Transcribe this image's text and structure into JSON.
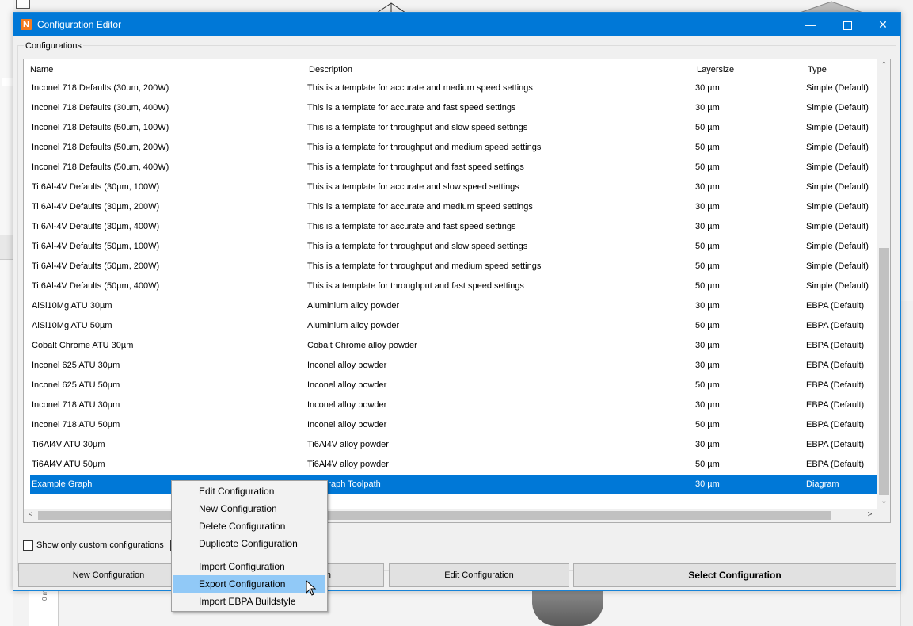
{
  "window": {
    "title": "Configuration Editor",
    "app_icon_letter": "N",
    "minimize": "—",
    "close": "✕"
  },
  "group": {
    "label": "Configurations"
  },
  "table": {
    "columns": [
      "Name",
      "Description",
      "Layersize",
      "Type"
    ],
    "rows": [
      {
        "name": "Inconel 718 Defaults (30µm, 200W)",
        "description": "This is a template for accurate and medium speed settings",
        "layersize": "30 µm",
        "type": "Simple (Default)"
      },
      {
        "name": "Inconel 718 Defaults (30µm, 400W)",
        "description": "This is a template for accurate and fast speed settings",
        "layersize": "30 µm",
        "type": "Simple (Default)"
      },
      {
        "name": "Inconel 718 Defaults (50µm, 100W)",
        "description": "This is a template for throughput and slow speed settings",
        "layersize": "50 µm",
        "type": "Simple (Default)"
      },
      {
        "name": "Inconel 718 Defaults (50µm, 200W)",
        "description": "This is a template for throughput and medium speed settings",
        "layersize": "50 µm",
        "type": "Simple (Default)"
      },
      {
        "name": "Inconel 718 Defaults (50µm, 400W)",
        "description": "This is a template for throughput and fast speed settings",
        "layersize": "50 µm",
        "type": "Simple (Default)"
      },
      {
        "name": "Ti 6Al-4V Defaults (30µm, 100W)",
        "description": "This is a template for accurate and slow speed settings",
        "layersize": "30 µm",
        "type": "Simple (Default)"
      },
      {
        "name": "Ti 6Al-4V Defaults (30µm, 200W)",
        "description": "This is a template for accurate and medium speed settings",
        "layersize": "30 µm",
        "type": "Simple (Default)"
      },
      {
        "name": "Ti 6Al-4V Defaults (30µm, 400W)",
        "description": "This is a template for accurate and fast speed settings",
        "layersize": "30 µm",
        "type": "Simple (Default)"
      },
      {
        "name": "Ti 6Al-4V Defaults (50µm, 100W)",
        "description": "This is a template for throughput and slow speed settings",
        "layersize": "50 µm",
        "type": "Simple (Default)"
      },
      {
        "name": "Ti 6Al-4V Defaults (50µm, 200W)",
        "description": "This is a template for throughput and medium speed settings",
        "layersize": "50 µm",
        "type": "Simple (Default)"
      },
      {
        "name": "Ti 6Al-4V Defaults (50µm, 400W)",
        "description": "This is a template for throughput and fast speed settings",
        "layersize": "50 µm",
        "type": "Simple (Default)"
      },
      {
        "name": "AlSi10Mg ATU 30µm",
        "description": "Aluminium alloy powder",
        "layersize": "30 µm",
        "type": "EBPA (Default)"
      },
      {
        "name": "AlSi10Mg ATU 50µm",
        "description": "Aluminium alloy powder",
        "layersize": "50 µm",
        "type": "EBPA (Default)"
      },
      {
        "name": "Cobalt Chrome ATU 30µm",
        "description": "Cobalt Chrome alloy powder",
        "layersize": "30 µm",
        "type": "EBPA (Default)"
      },
      {
        "name": "Inconel 625 ATU 30µm",
        "description": "Inconel alloy powder",
        "layersize": "30 µm",
        "type": "EBPA (Default)"
      },
      {
        "name": "Inconel 625 ATU 50µm",
        "description": "Inconel alloy powder",
        "layersize": "50 µm",
        "type": "EBPA (Default)"
      },
      {
        "name": "Inconel 718 ATU 30µm",
        "description": "Inconel alloy powder",
        "layersize": "30 µm",
        "type": "EBPA (Default)"
      },
      {
        "name": "Inconel 718 ATU 50µm",
        "description": "Inconel alloy powder",
        "layersize": "50 µm",
        "type": "EBPA (Default)"
      },
      {
        "name": "Ti6Al4V ATU 30µm",
        "description": "Ti6Al4V alloy powder",
        "layersize": "30 µm",
        "type": "EBPA (Default)"
      },
      {
        "name": "Ti6Al4V ATU 50µm",
        "description": "Ti6Al4V alloy powder",
        "layersize": "50 µm",
        "type": "EBPA (Default)"
      },
      {
        "name": "Example Graph",
        "description": "ple Graph Toolpath",
        "layersize": "30 µm",
        "type": "Diagram",
        "selected": true
      }
    ]
  },
  "checkbox": {
    "label": "Show only custom configurations",
    "checked": false
  },
  "buttons": {
    "new": "New Configuration",
    "delete_partial": "n",
    "edit": "Edit Configuration",
    "select": "Select Configuration"
  },
  "context_menu": {
    "items": [
      "Edit Configuration",
      "New Configuration",
      "Delete Configuration",
      "Duplicate Configuration",
      "Import Configuration",
      "Export Configuration",
      "Import EBPA Buildstyle"
    ],
    "highlighted": "Export Configuration"
  },
  "background": {
    "ruler_label": "0 mm"
  },
  "colors": {
    "accent": "#0078d7",
    "menu_highlight": "#91c9f7",
    "app_icon": "#f47b20"
  }
}
